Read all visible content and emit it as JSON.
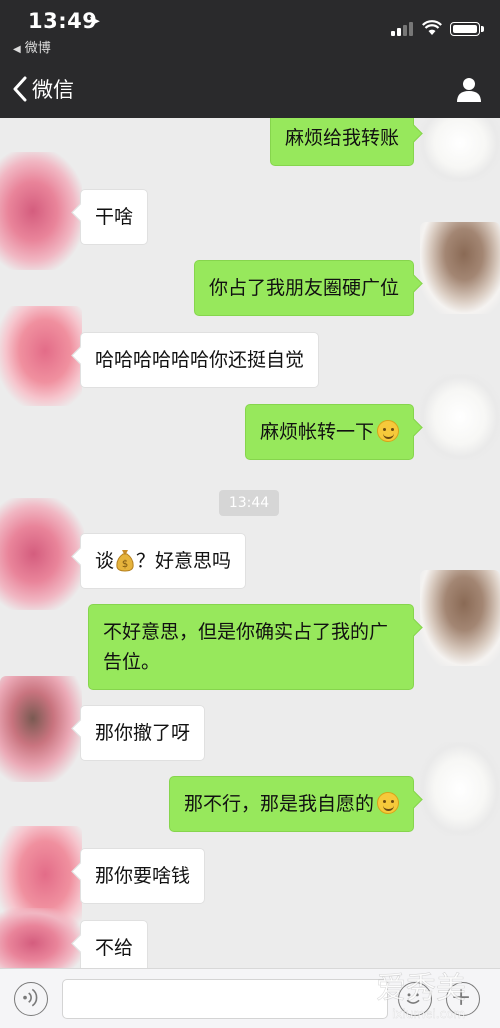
{
  "status_bar": {
    "time": "13:49",
    "back_app": "微博",
    "icons": [
      "location-arrow-icon",
      "signal-icon",
      "wifi-icon",
      "battery-icon"
    ]
  },
  "nav": {
    "back_label": "微信",
    "icons": [
      "chevron-left-icon",
      "person-icon"
    ]
  },
  "messages": [
    {
      "side": "out",
      "text": "麻烦给我转账"
    },
    {
      "side": "in",
      "text": "干啥"
    },
    {
      "side": "out",
      "text": "你占了我朋友圈硬广位"
    },
    {
      "side": "in",
      "text": "哈哈哈哈哈哈你还挺自觉"
    },
    {
      "side": "out",
      "text": "麻烦帐转一下",
      "emoji": "smile-emoji"
    },
    {
      "type": "time",
      "text": "13:44"
    },
    {
      "side": "in",
      "text_before": "谈",
      "emoji": "money-bag-emoji",
      "text_after": "？好意思吗"
    },
    {
      "side": "out",
      "text": "不好意思，但是你确实占了我的广告位。"
    },
    {
      "side": "in",
      "text": "那你撤了呀"
    },
    {
      "side": "out",
      "text": "那不行，那是我自愿的",
      "emoji": "smile-emoji"
    },
    {
      "side": "in",
      "text": "那你要啥钱"
    },
    {
      "side": "in",
      "text": "不给"
    }
  ],
  "input_bar": {
    "icons": [
      "voice-icon",
      "emoji-icon",
      "plus-icon"
    ]
  },
  "watermark": {
    "text": "爱秀美",
    "sub": "ixiumei.com"
  }
}
